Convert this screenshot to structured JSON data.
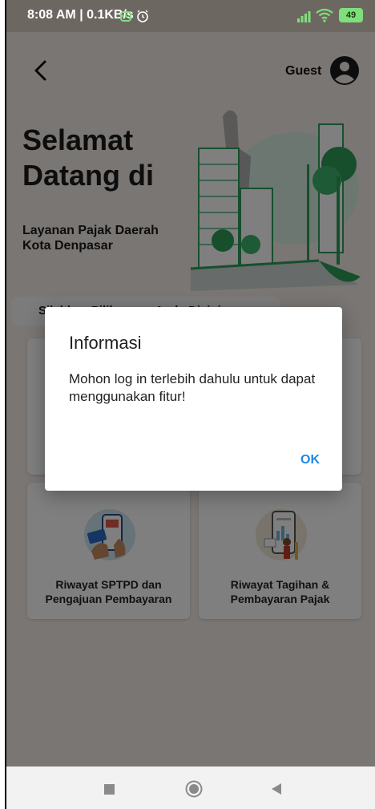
{
  "status_bar": {
    "time_speed": "8:08 AM | 0.1KB/s",
    "battery": "49"
  },
  "header": {
    "guest_label": "Guest"
  },
  "hero": {
    "welcome_line1": "Selamat",
    "welcome_line2": "Datang di",
    "subtitle_line1": "Layanan Pajak Daerah",
    "subtitle_line2": "Kota Denpasar"
  },
  "section": {
    "label": "Silahkan Pilih menu Anda Disini"
  },
  "cards": [
    {
      "label_line1": "",
      "label_line2": ""
    },
    {
      "label_line1": "",
      "label_line2": ""
    },
    {
      "label_line1": "Riwayat SPTPD dan",
      "label_line2": "Pengajuan Pembayaran"
    },
    {
      "label_line1": "Riwayat Tagihan &",
      "label_line2": "Pembayaran Pajak"
    }
  ],
  "dialog": {
    "title": "Informasi",
    "message": "Mohon log in terlebih dahulu untuk dapat menggunakan fitur!",
    "ok_label": "OK"
  },
  "colors": {
    "status_bar": "#6d6762",
    "app_background": "#f3ece8",
    "accent_green": "#2e9e5b",
    "ok_blue": "#1e88e5"
  },
  "icons": {
    "back": "chevron-left-icon",
    "avatar": "account-circle-icon",
    "alarm": "alarm-icon",
    "clock": "clock-icon",
    "signal": "signal-icon",
    "wifi": "wifi-icon",
    "nav_recent": "square-icon",
    "nav_home": "circle-icon",
    "nav_back": "triangle-back-icon"
  }
}
